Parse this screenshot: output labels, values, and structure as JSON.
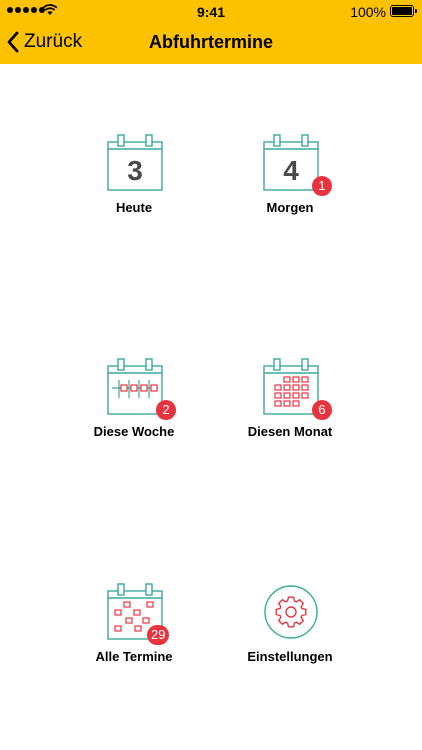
{
  "status_bar": {
    "time": "9:41",
    "battery": "100%"
  },
  "nav": {
    "back_label": "Zurück",
    "title": "Abfuhrtermine"
  },
  "colors": {
    "header": "#fcc200",
    "calendar_teal": "#3aa99f",
    "marks_red": "#e8343f",
    "badge": "#e8343f"
  },
  "tiles": [
    {
      "label": "Heute",
      "icon": "calendar-day-icon",
      "day_number": "3"
    },
    {
      "label": "Morgen",
      "icon": "calendar-day-icon",
      "day_number": "4",
      "badge": "1"
    },
    {
      "label": "Diese Woche",
      "icon": "calendar-week-icon",
      "badge": "2"
    },
    {
      "label": "Diesen Monat",
      "icon": "calendar-month-icon",
      "badge": "6"
    },
    {
      "label": "Alle Termine",
      "icon": "calendar-all-icon",
      "badge": "29"
    },
    {
      "label": "Einstellungen",
      "icon": "gear-icon"
    }
  ]
}
